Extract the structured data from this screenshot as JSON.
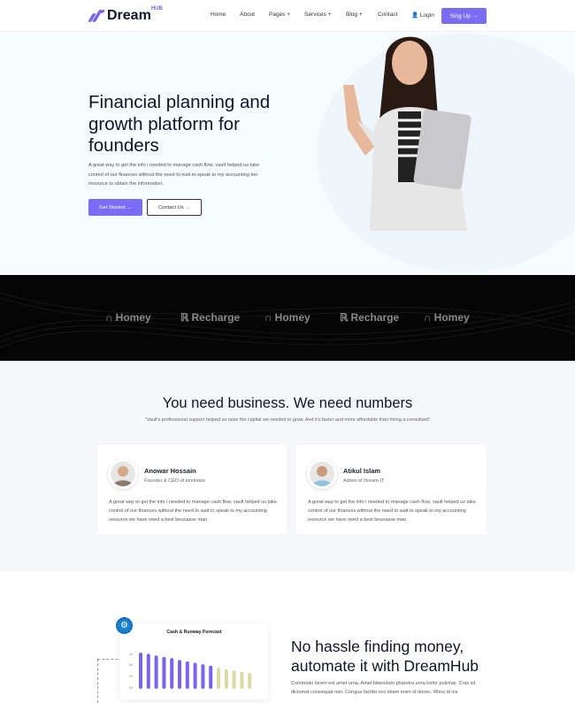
{
  "header": {
    "logo": "Dream",
    "logo_sup": "HUB",
    "nav": [
      "Home",
      "About",
      "Pages +",
      "Services +",
      "Blog +",
      "Contact"
    ],
    "login": "Login",
    "signup": "Sing Up →"
  },
  "hero": {
    "title": "Financial planning and growth platform for founders",
    "text": "A great way to get the info i needed to manage cash flow. vault helped us take control of our finances without the need to wait to speak to my accounting ton resource to obtain the information.",
    "primary": "Get Started →",
    "secondary": "Contact Us →"
  },
  "brands": [
    "Homey",
    "Recharge",
    "Homey",
    "Recharge",
    "Homey"
  ],
  "testimonials": {
    "title": "You need business. We need numbers",
    "quote": "\"Vault's professional support helped us raise the capital we needed to grow. And it's faster and more affordable than hiring a consultant\"",
    "cards": [
      {
        "name": "Anowar Hossain",
        "role": "Founder & CEO of luminous",
        "text": "A great way to get the info i needed to manage cash flow. vault helped us take control of our finances without the need to wait to speak to my accounting resource we have need a best beunasse man"
      },
      {
        "name": "Atikul Islam",
        "role": "Admin of Dream-IT",
        "text": "A great way to get the info i needed to manage cash flow. vault helped us take control of our finances without the need to wait to speak to my accounting resource we have need a best beunasse man"
      }
    ]
  },
  "feature": {
    "title": "No hassle finding money, automate it with DreamHub",
    "text": "Commodo lorem est amet urna. Amet bibendum pharetra urna tortor pulvinar. Cras sit dictumst consequat non. Congue facilisi orci etiam enim id donec. Rhos id nis"
  },
  "chart_data": {
    "type": "bar",
    "title": "Cash & Runway Forecast",
    "yticks": [
      "10",
      "06",
      "03",
      "01"
    ],
    "ylim": [
      0,
      10
    ],
    "values": [
      10,
      9.7,
      9.2,
      8.8,
      8.5,
      8,
      7.6,
      7.2,
      6.8,
      6.4,
      5.8,
      5.4,
      5,
      4.7,
      4.4
    ],
    "colors": [
      "#7b63ef",
      "#7b63ef",
      "#7b63ef",
      "#7b63ef",
      "#7b63ef",
      "#7b63ef",
      "#7b63ef",
      "#7b63ef",
      "#7b63ef",
      "#7b63ef",
      "#d9dba3",
      "#d9dba3",
      "#d9dba3",
      "#d9dba3",
      "#d9dba3"
    ]
  },
  "colors": {
    "accent": "#7b6cf6",
    "dark": "#050505"
  }
}
